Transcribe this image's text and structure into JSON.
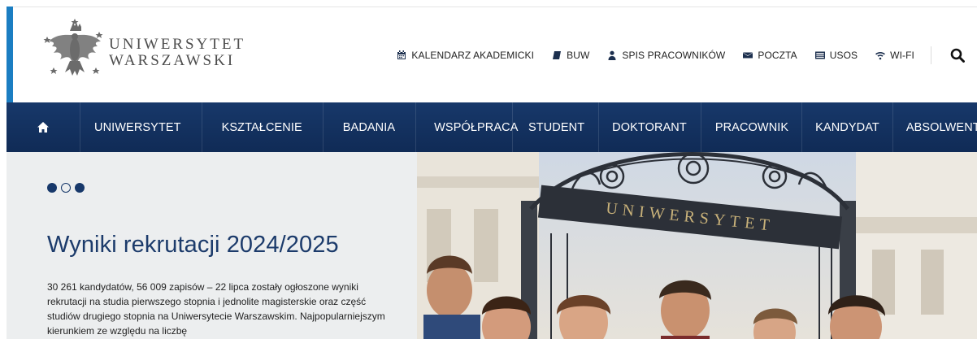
{
  "logo": {
    "line1": "UNIWERSYTET",
    "line2": "WARSZAWSKI",
    "emblem": "eagle-emblem"
  },
  "toplinks": [
    {
      "label": "KALENDARZ AKADEMICKI",
      "icon": "calendar-icon"
    },
    {
      "label": "BUW",
      "icon": "book-icon"
    },
    {
      "label": "SPIS PRACOWNIKÓW",
      "icon": "user-icon"
    },
    {
      "label": "POCZTA",
      "icon": "envelope-icon"
    },
    {
      "label": "USOS",
      "icon": "list-icon"
    },
    {
      "label": "WI-FI",
      "icon": "wifi-icon"
    }
  ],
  "search": {
    "icon": "search-icon"
  },
  "nav": {
    "home_icon": "home-icon",
    "left": [
      "UNIWERSYTET",
      "KSZTAŁCENIE",
      "BADANIA",
      "WSPÓŁPRACA"
    ],
    "right": [
      "STUDENT",
      "DOKTORANT",
      "PRACOWNIK",
      "KANDYDAT",
      "ABSOLWENT"
    ]
  },
  "hero": {
    "slides": 3,
    "active_slide": 1,
    "title": "Wyniki rekrutacji 2024/2025",
    "text": "30 261 kandydatów, 56 009 zapisów – 22 lipca zostały ogłoszone wyniki rekrutacji na studia pierwszego stopnia i jednolite magisterskie oraz część studiów drugiego stopnia na Uniwersytecie Warszawskim. Najpopularniejszym kierunkiem ze względu na liczbę",
    "gate_sign": "UNIWERSYTET"
  },
  "colors": {
    "nav": "#17386a",
    "accent": "#1b7ec2",
    "title": "#1c3b6b",
    "hero_bg": "#eceeef"
  }
}
